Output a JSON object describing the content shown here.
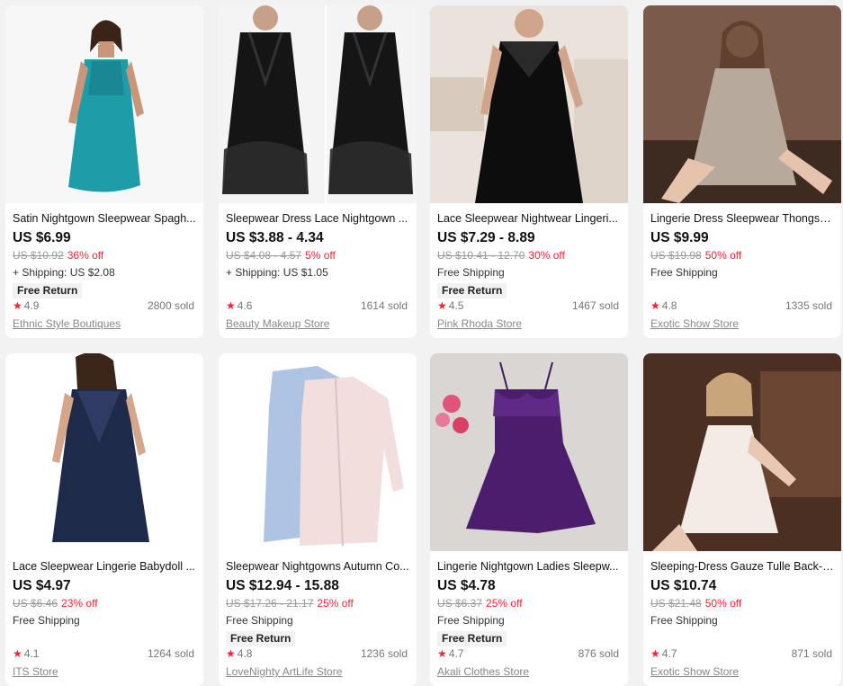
{
  "products": [
    {
      "title": "Satin Nightgown Sleepwear Spagh...",
      "price": "US $6.99",
      "original": "US $10.92",
      "discount": "36% off",
      "shipping": "+ Shipping: US $2.08",
      "free_return": "Free Return",
      "rating": "4.9",
      "sold": "2800 sold",
      "store": "Ethnic Style Boutiques"
    },
    {
      "title": "Sleepwear Dress Lace Nightgown ...",
      "price": "US $3.88 - 4.34",
      "original": "US $4.08 - 4.57",
      "discount": "5% off",
      "shipping": "+ Shipping: US $1.05",
      "free_return": "",
      "rating": "4.6",
      "sold": "1614 sold",
      "store": "Beauty Makeup Store"
    },
    {
      "title": "Lace Sleepwear Nightwear Lingeri...",
      "price": "US $7.29 - 8.89",
      "original": "US $10.41 - 12.70",
      "discount": "30% off",
      "shipping": "Free Shipping",
      "free_return": "Free Return",
      "rating": "4.5",
      "sold": "1467 sold",
      "store": "Pink Rhoda Store"
    },
    {
      "title": "Lingerie Dress Sleepwear Thongs S...",
      "price": "US $9.99",
      "original": "US $19.98",
      "discount": "50% off",
      "shipping": "Free Shipping",
      "free_return": "",
      "rating": "4.8",
      "sold": "1335 sold",
      "store": "Exotic Show Store"
    },
    {
      "title": "Lace Sleepwear Lingerie Babydoll ...",
      "price": "US $4.97",
      "original": "US $6.46",
      "discount": "23% off",
      "shipping": "Free Shipping",
      "free_return": "",
      "rating": "4.1",
      "sold": "1264 sold",
      "store": "ITS Store"
    },
    {
      "title": "Sleepwear Nightgowns Autumn Co...",
      "price": "US $12.94 - 15.88",
      "original": "US $17.26 - 21.17",
      "discount": "25% off",
      "shipping": "Free Shipping",
      "free_return": "Free Return",
      "rating": "4.8",
      "sold": "1236 sold",
      "store": "LoveNighty ArtLife Store"
    },
    {
      "title": "Lingerie Nightgown Ladies Sleepw...",
      "price": "US $4.78",
      "original": "US $6.37",
      "discount": "25% off",
      "shipping": "Free Shipping",
      "free_return": "Free Return",
      "rating": "4.7",
      "sold": "876 sold",
      "store": "Akali Clothes Store"
    },
    {
      "title": "Sleeping-Dress Gauze Tulle Back-L...",
      "price": "US $10.74",
      "original": "US $21.48",
      "discount": "50% off",
      "shipping": "Free Shipping",
      "free_return": "",
      "rating": "4.7",
      "sold": "871 sold",
      "store": "Exotic Show Store"
    }
  ],
  "icons": {
    "rating": "star-icon"
  },
  "colors": {
    "accent": "#ff2233",
    "price": "#111111",
    "muted": "#999999"
  }
}
